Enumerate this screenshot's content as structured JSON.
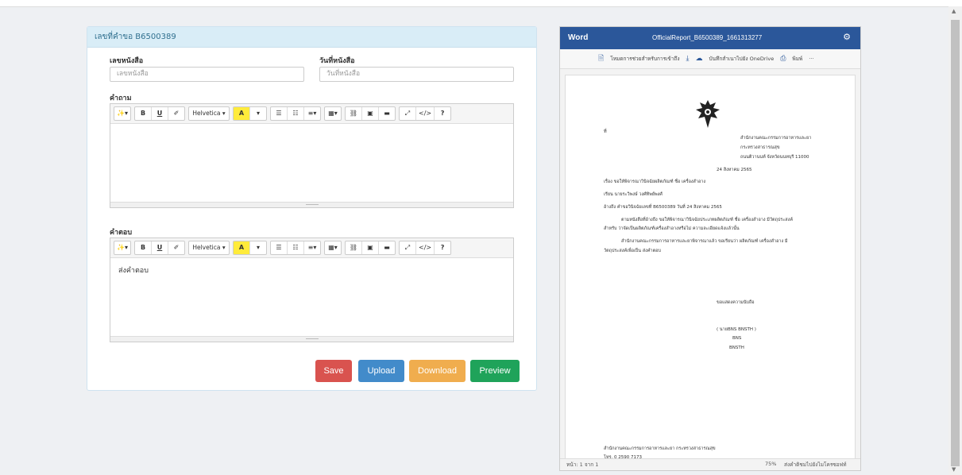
{
  "panel": {
    "title": "เลขที่คำขอ B6500389",
    "doc_no_label": "เลขหนังสือ",
    "doc_no_placeholder": "เลขหนังสือ",
    "doc_date_label": "วันที่หนังสือ",
    "doc_date_placeholder": "วันที่หนังสือ",
    "question_label": "คำถาม",
    "answer_label": "คำตอบ",
    "answer_text": "ส่งคำตอบ"
  },
  "toolbar": {
    "magic": "✨▾",
    "bold": "B",
    "underline": "U",
    "eraser": "✐",
    "font": "Helvetica ▾",
    "color": "A",
    "color_caret": "▾",
    "ul": "☰",
    "ol": "☷",
    "align": "≡▾",
    "table": "▦▾",
    "link": "⛓",
    "image": "▣",
    "video": "▬",
    "fullscreen": "⤢",
    "code": "</>",
    "help": "?"
  },
  "buttons": {
    "save": "Save",
    "upload": "Upload",
    "download": "Download",
    "preview": "Preview"
  },
  "colors": {
    "save": "#d9534f",
    "upload": "#428bca",
    "download": "#f0ad4e",
    "preview": "#1fa35a",
    "word_blue": "#2b579a"
  },
  "word": {
    "app": "Word",
    "file": "OfficialReport_B6500389_1661313277",
    "tools": {
      "download_doc": "โหมดการช่วยสำหรับการเข้าถึง",
      "save_onedrive": "บันทึกสำเนาไปยัง OneDrive",
      "print": "พิมพ์",
      "more": "···"
    },
    "doc": {
      "ref": "ที่",
      "org1": "สำนักงานคณะกรรมการอาหารและยา",
      "org2": "กระทรวงสาธารณสุข",
      "org3": "ถนนติวานนท์ จังหวัดนนทบุรี 11000",
      "date": "24 สิงหาคม 2565",
      "subject": "เรื่อง  ขอให้พิจารณาวินิจฉัยผลิตภัณฑ์ ชื่อ เครื่องสำอาง",
      "to": "เรียน  นายระวิพงษ์ วงศ์ทิพย์พงศ์",
      "refer": "อ้างถึง  คำขอวินิจฉัยเลขที่ B6500389 วันที่ 24 สิงหาคม 2565",
      "para1a": "ตามหนังสือที่อ้างถึง ขอให้พิจารณาวินิจฉัยประเภทผลิตภัณฑ์ ชื่อ เครื่องสำอาง มีวัตถุประสงค์",
      "para1b": "สำหรับ ว่าจัดเป็นผลิตภัณฑ์เครื่องสำอางหรือไม่ ความละเอียดแจ้งแล้วนั้น",
      "para2a": "สำนักงานคณะกรรมการอาหารและยาพิจารณาแล้ว ขอเรียนว่า ผลิตภัณฑ์ เครื่องสำอาง มี",
      "para2b": "วัตถุประสงค์เพื่อเป็น ส่งคำตอบ",
      "closing": "ขอแสดงความนับถือ",
      "sign1": "( นายBNS BNSTH )",
      "sign2": "BNS",
      "sign3": "BNSTH",
      "footer1": "สำนักงานคณะกรรมการอาหารและยา กระทรวงสาธารณสุข",
      "footer2": "โทร. 0 2590 7173"
    },
    "status": {
      "page": "หน้า: 1 จาก 1",
      "zoom": "75%",
      "feedback": "ส่งคำติชมไปยังไมโครซอฟท์"
    }
  },
  "scroll": {
    "up": "▲",
    "down": "▼"
  }
}
